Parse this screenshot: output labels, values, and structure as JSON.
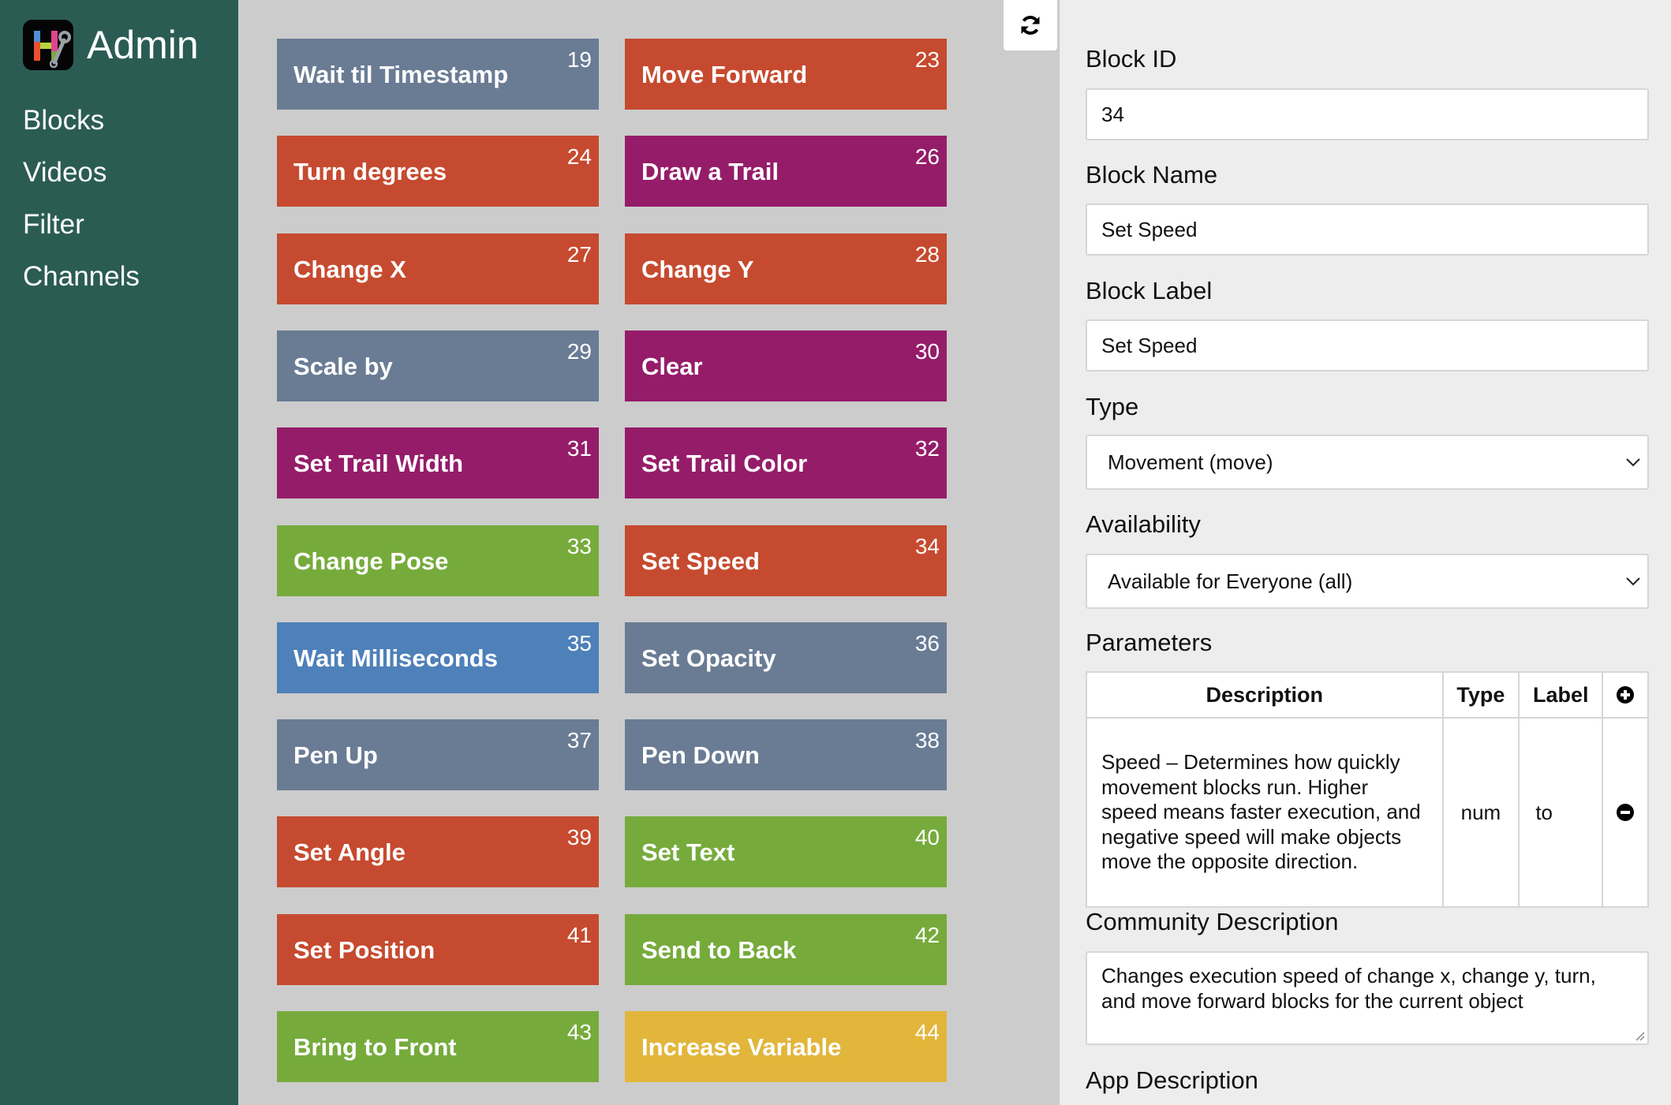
{
  "sidebar": {
    "title": "Admin",
    "logo_icon": "hour-of-code-admin-logo",
    "items": [
      {
        "label": "Blocks"
      },
      {
        "label": "Videos"
      },
      {
        "label": "Filter"
      },
      {
        "label": "Channels"
      }
    ]
  },
  "colors": {
    "sidebar": "#2b5c54",
    "grid_background": "#cccccc",
    "panel_background": "#ededed",
    "slate": "#6a7c94",
    "orange": "#c64a2f",
    "magenta": "#951c69",
    "green": "#76ab3c",
    "blue": "#4e80b9",
    "yellow": "#e1b63b"
  },
  "refresh_button": {
    "icon": "refresh-icon"
  },
  "blocks": [
    {
      "name": "Wait til Timestamp",
      "id": "19",
      "color": "slate"
    },
    {
      "name": "Move Forward",
      "id": "23",
      "color": "orange"
    },
    {
      "name": "Turn degrees",
      "id": "24",
      "color": "orange"
    },
    {
      "name": "Draw a Trail",
      "id": "26",
      "color": "magenta"
    },
    {
      "name": "Change X",
      "id": "27",
      "color": "orange"
    },
    {
      "name": "Change Y",
      "id": "28",
      "color": "orange"
    },
    {
      "name": "Scale by",
      "id": "29",
      "color": "slate"
    },
    {
      "name": "Clear",
      "id": "30",
      "color": "magenta"
    },
    {
      "name": "Set Trail Width",
      "id": "31",
      "color": "magenta"
    },
    {
      "name": "Set Trail Color",
      "id": "32",
      "color": "magenta"
    },
    {
      "name": "Change Pose",
      "id": "33",
      "color": "green"
    },
    {
      "name": "Set Speed",
      "id": "34",
      "color": "orange"
    },
    {
      "name": "Wait Milliseconds",
      "id": "35",
      "color": "blue"
    },
    {
      "name": "Set Opacity",
      "id": "36",
      "color": "slate"
    },
    {
      "name": "Pen Up",
      "id": "37",
      "color": "slate"
    },
    {
      "name": "Pen Down",
      "id": "38",
      "color": "slate"
    },
    {
      "name": "Set Angle",
      "id": "39",
      "color": "orange"
    },
    {
      "name": "Set Text",
      "id": "40",
      "color": "green"
    },
    {
      "name": "Set Position",
      "id": "41",
      "color": "orange"
    },
    {
      "name": "Send to Back",
      "id": "42",
      "color": "green"
    },
    {
      "name": "Bring to Front",
      "id": "43",
      "color": "green"
    },
    {
      "name": "Increase Variable",
      "id": "44",
      "color": "yellow"
    }
  ],
  "form": {
    "block_id": {
      "label": "Block ID",
      "value": "34"
    },
    "block_name": {
      "label": "Block Name",
      "value": "Set Speed"
    },
    "block_label": {
      "label": "Block Label",
      "value": "Set Speed"
    },
    "type": {
      "label": "Type",
      "selected": "Movement (move)"
    },
    "availability": {
      "label": "Availability",
      "selected": "Available for Everyone (all)"
    },
    "parameters": {
      "label": "Parameters",
      "columns": [
        "Description",
        "Type",
        "Label"
      ],
      "add_icon": "plus-circle-icon",
      "rows": [
        {
          "description": "Speed – Determines how quickly movement blocks run. Higher speed means faster execution, and negative speed will make objects move the opposite direction.",
          "type": "num",
          "label": "to",
          "remove_icon": "minus-circle-icon"
        }
      ]
    },
    "community_description": {
      "label": "Community Description",
      "value": "Changes execution speed of change x, change y, turn, and move forward blocks for the current object"
    },
    "app_description": {
      "label": "App Description"
    }
  }
}
